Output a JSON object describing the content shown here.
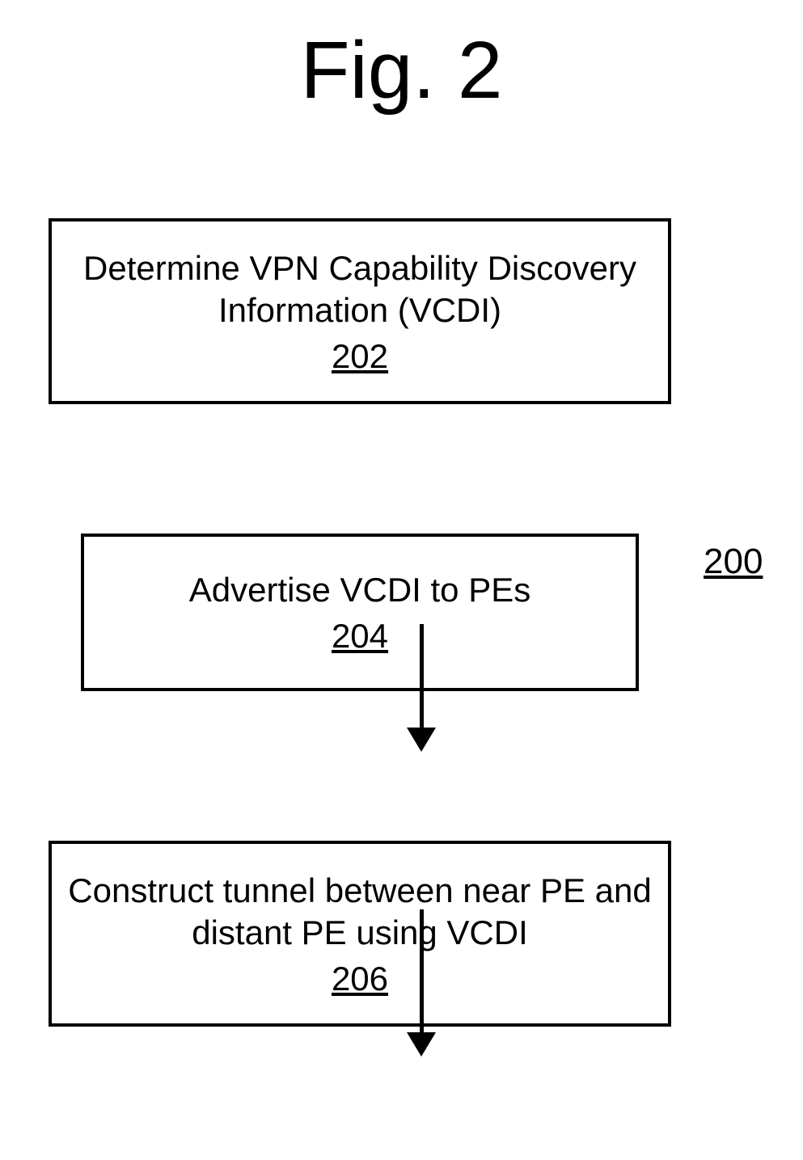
{
  "figure": {
    "title": "Fig. 2",
    "reference": "200"
  },
  "boxes": [
    {
      "text": "Determine VPN Capability Discovery Information (VCDI)",
      "ref": "202"
    },
    {
      "text": "Advertise VCDI to PEs",
      "ref": "204"
    },
    {
      "text": "Construct tunnel between near PE and distant PE using VCDI",
      "ref": "206"
    }
  ],
  "chart_data": {
    "type": "flowchart",
    "title": "Fig. 2",
    "nodes": [
      {
        "id": "202",
        "label": "Determine VPN Capability Discovery Information (VCDI)"
      },
      {
        "id": "204",
        "label": "Advertise VCDI to PEs"
      },
      {
        "id": "206",
        "label": "Construct tunnel between near PE and distant PE using VCDI"
      }
    ],
    "edges": [
      {
        "from": "202",
        "to": "204"
      },
      {
        "from": "204",
        "to": "206"
      }
    ],
    "figure_reference": "200"
  }
}
